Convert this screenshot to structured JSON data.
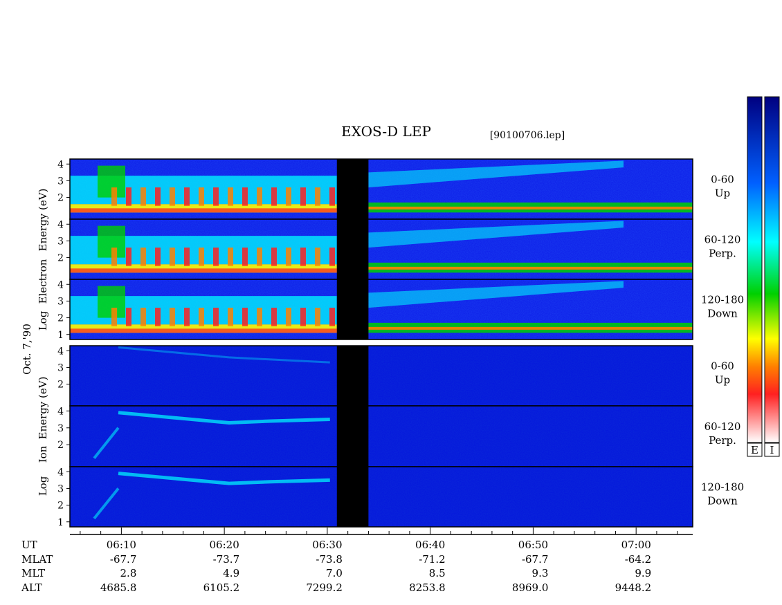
{
  "chart_data": {
    "type": "heatmap",
    "title": "EXOS-D LEP",
    "file_label": "[90100706.lep]",
    "date_label": "Oct. 7,'90",
    "electron_ylabel": [
      "Log",
      "Electron",
      "Energy (eV)"
    ],
    "ion_ylabel": [
      "Log",
      "Ion",
      "Energy (eV)"
    ],
    "ylim": [
      1,
      4
    ],
    "yticks": [
      "4",
      "3",
      "2"
    ],
    "yticks_low": [
      "4",
      "3",
      "2",
      "1"
    ],
    "panels": [
      {
        "species": "electron",
        "pitch": "0-60",
        "dir": "Up"
      },
      {
        "species": "electron",
        "pitch": "60-120",
        "dir": "Perp."
      },
      {
        "species": "electron",
        "pitch": "120-180",
        "dir": "Down"
      },
      {
        "species": "ion",
        "pitch": "0-60",
        "dir": "Up"
      },
      {
        "species": "ion",
        "pitch": "60-120",
        "dir": "Perp."
      },
      {
        "species": "ion",
        "pitch": "120-180",
        "dir": "Down"
      }
    ],
    "data_gap": [
      "06:31",
      "06:34"
    ],
    "colorbars": [
      "E",
      "I"
    ],
    "colorscale": [
      "#ffffff",
      "#ff2020",
      "#ff8000",
      "#ffff00",
      "#00d000",
      "#00ffff",
      "#0060ff",
      "#000080"
    ],
    "ephemeris": {
      "row_labels": [
        "UT",
        "MLAT",
        "MLT",
        "ALT"
      ],
      "columns": [
        {
          "UT": "06:10",
          "MLAT": "-67.7",
          "MLT": "2.8",
          "ALT": "4685.8"
        },
        {
          "UT": "06:20",
          "MLAT": "-73.7",
          "MLT": "4.9",
          "ALT": "6105.2"
        },
        {
          "UT": "06:30",
          "MLAT": "-73.8",
          "MLT": "7.0",
          "ALT": "7299.2"
        },
        {
          "UT": "06:40",
          "MLAT": "-71.2",
          "MLT": "8.5",
          "ALT": "8253.8"
        },
        {
          "UT": "06:50",
          "MLAT": "-67.7",
          "MLT": "9.3",
          "ALT": "8969.0"
        },
        {
          "UT": "07:00",
          "MLAT": "-64.2",
          "MLT": "9.9",
          "ALT": "9448.2"
        }
      ]
    }
  }
}
